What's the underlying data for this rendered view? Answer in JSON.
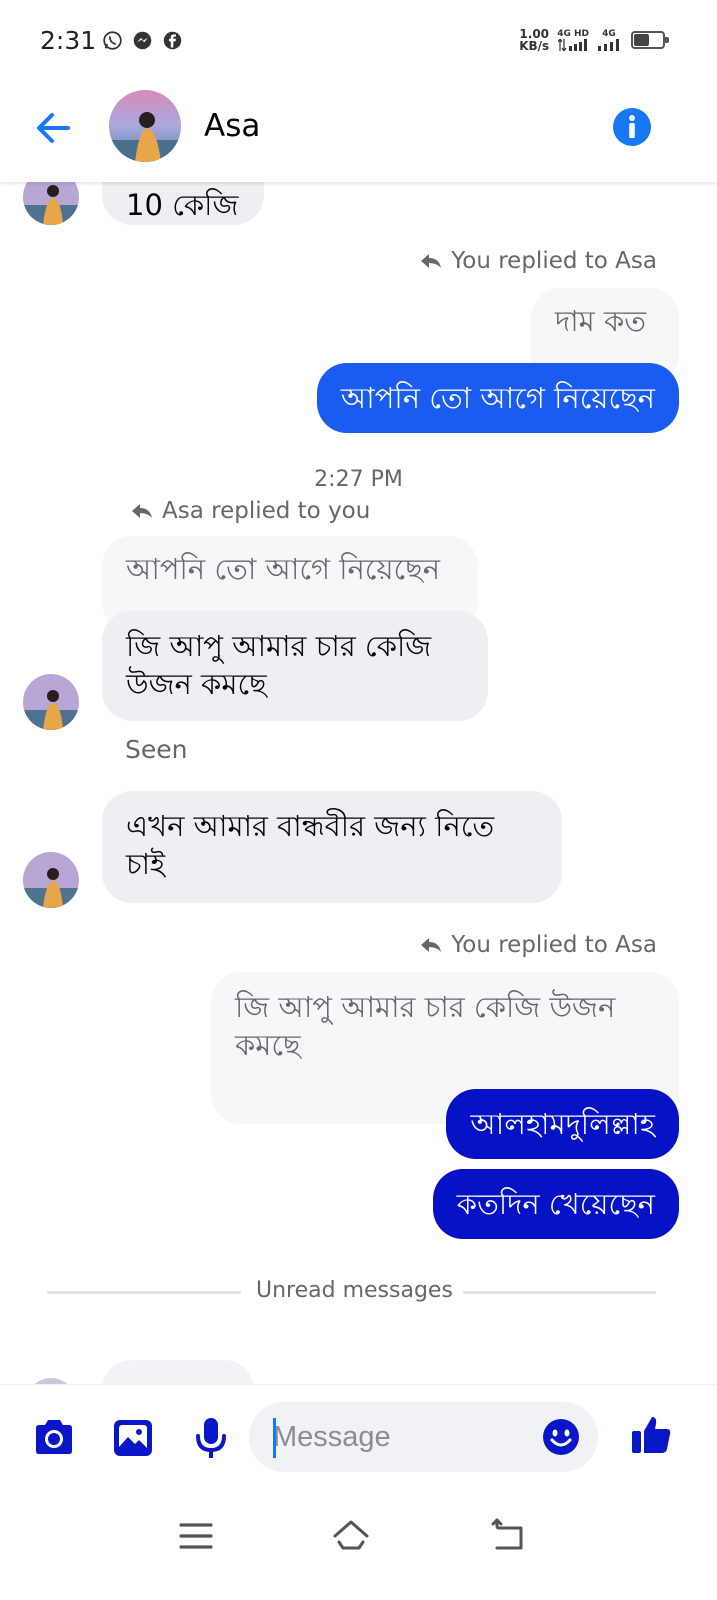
{
  "status_bar": {
    "time": "2:31",
    "net_speed_value": "1.00",
    "net_speed_unit": "KB/s",
    "sim1_label": "4G HD",
    "sim2_label": "4G",
    "battery_level": 0.55
  },
  "header": {
    "contact_name": "Asa"
  },
  "messages": {
    "top_partial": "10 কেজি",
    "reply1_label": "You replied to Asa",
    "reply1_quote": "দাম কত",
    "reply1_text": "আপনি তো আগে নিয়েছেন",
    "timestamp": "2:27 PM",
    "reply2_label": "Asa replied to you",
    "reply2_quote": "আপনি তো আগে নিয়েছেন",
    "reply2_text_line1": "জি আপু আমার  চার কেজি",
    "reply2_text_line2": "উজন কমছে",
    "seen": "Seen",
    "incoming3_line1": "এখন আমার বান্ধবীর জন্য নিতে",
    "incoming3_line2": "চাই",
    "reply3_label": "You replied to Asa",
    "reply3_quote_line1": "জি আপু আমার  চার কেজি উজন",
    "reply3_quote_line2": "কমছে",
    "outgoing4": "আলহামদুলিল্লাহ",
    "outgoing5": "কতদিন খেয়েছেন",
    "unread_divider": "Unread messages"
  },
  "composer": {
    "placeholder": "Message"
  },
  "colors": {
    "accent": "#1877f2",
    "bubble_out_blue": "#1a5cf0",
    "bubble_out_dark": "#0612c6",
    "bubble_in": "#eeeff3",
    "composer_icon": "#0a17c9"
  },
  "icons": {
    "back": "arrow-left-icon",
    "info": "info-icon",
    "camera": "camera-icon",
    "gallery": "image-icon",
    "mic": "microphone-icon",
    "emoji": "smiley-icon",
    "like": "thumbs-up-icon"
  }
}
